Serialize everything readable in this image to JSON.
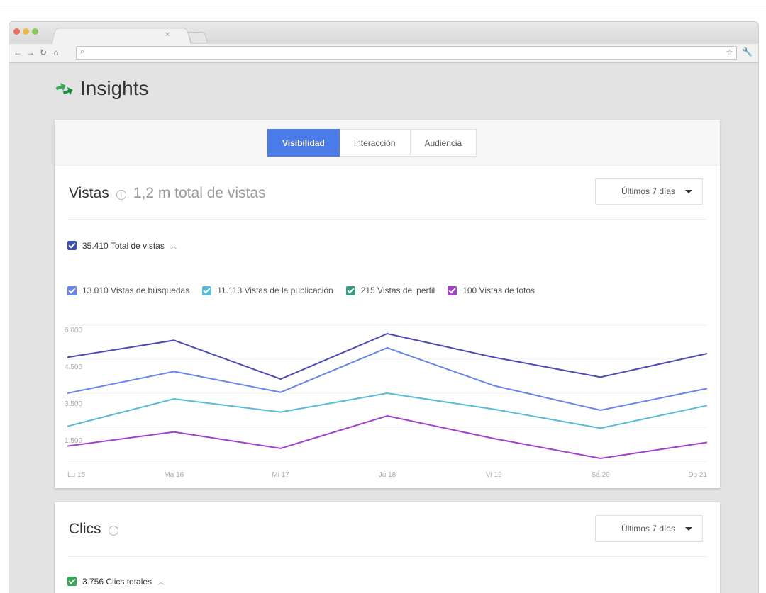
{
  "app": {
    "title": "Insights"
  },
  "browser": {
    "address": ""
  },
  "tabs": [
    {
      "label": "Visibilidad",
      "active": true
    },
    {
      "label": "Interacción",
      "active": false
    },
    {
      "label": "Audiencia",
      "active": false
    }
  ],
  "views": {
    "title": "Vistas",
    "total_summary": "1,2 m total de vistas",
    "range": "Últimos 7 días",
    "total_label": "35.410 Total de vistas",
    "legend": [
      {
        "label": "13.010 Vistas de búsquedas",
        "color": "#6b84e9"
      },
      {
        "label": "11.113 Vistas de la publicación",
        "color": "#5bbad6"
      },
      {
        "label": "215 Vistas del perfil",
        "color": "#3a9a80"
      },
      {
        "label": "100 Vistas de fotos",
        "color": "#a141c9"
      }
    ]
  },
  "clicks": {
    "title": "Clics",
    "range": "Últimos 7 días",
    "total_label": "3.756 Clics totales"
  },
  "colors": {
    "accent": "#4a7be8",
    "total_series": "#4d4ab3",
    "check_total": "#3d4fb4",
    "check_clicks": "#34a853"
  },
  "chart_data": {
    "type": "line",
    "categories": [
      "Lu 15",
      "Ma 16",
      "Mi 17",
      "Ju 18",
      "Vi 19",
      "Sá 20",
      "Do 21"
    ],
    "y_ticks": [
      "6.000",
      "4.500",
      "3.500",
      "1.500"
    ],
    "series": [
      {
        "name": "35.410 Total de vistas",
        "color": "#4d4ab3",
        "values": [
          5500,
          6400,
          4350,
          6750,
          5500,
          4450,
          5700
        ]
      },
      {
        "name": "13.010 Vistas de búsquedas",
        "color": "#6b84e9",
        "values": [
          3600,
          4750,
          3650,
          6000,
          4000,
          2700,
          3850
        ]
      },
      {
        "name": "11.113 Vistas de la publicación",
        "color": "#5bbad6",
        "values": [
          1850,
          3300,
          2600,
          3600,
          2750,
          1750,
          2950
        ]
      },
      {
        "name": "100 Vistas de fotos",
        "color": "#a141c9",
        "values": [
          800,
          1550,
          680,
          2400,
          1200,
          150,
          1000
        ]
      }
    ],
    "ylim": [
      0,
      7200
    ],
    "grid": true
  }
}
